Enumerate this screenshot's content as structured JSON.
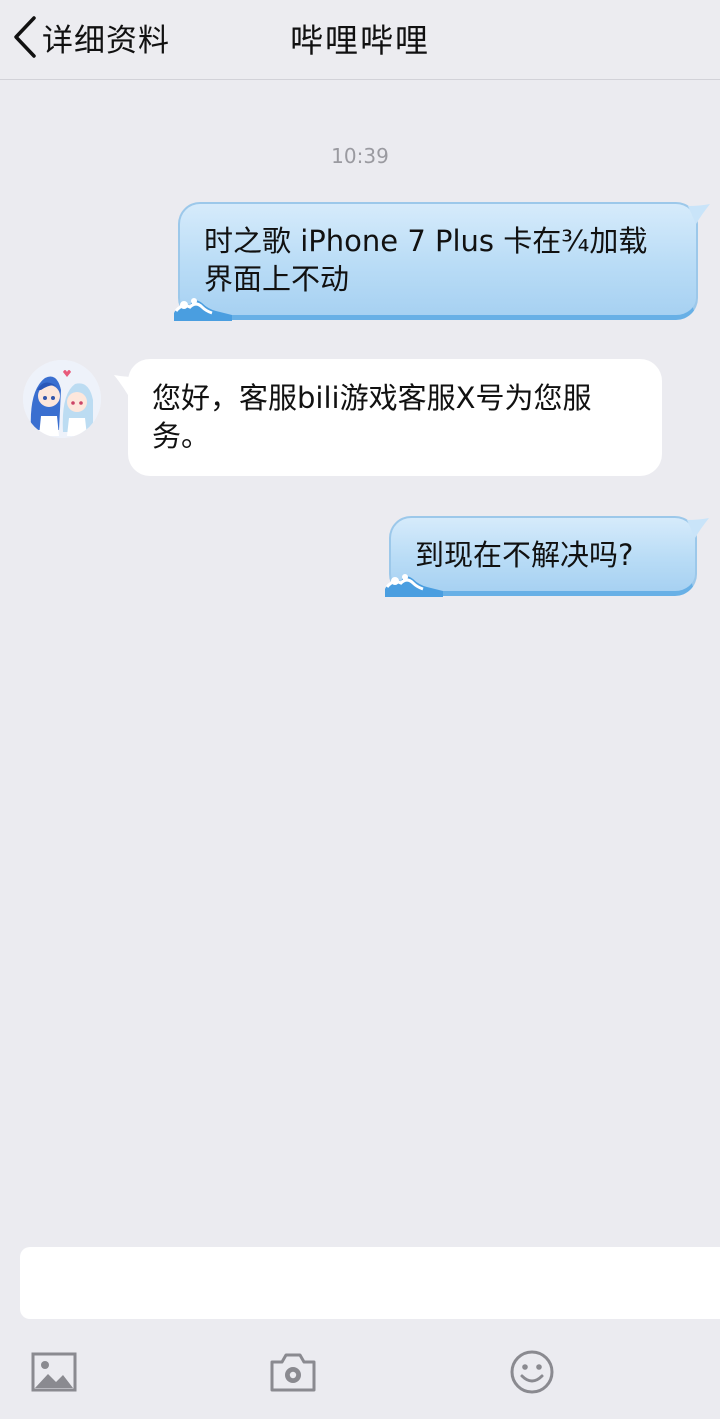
{
  "nav": {
    "back_label": "详细资料",
    "title": "哔哩哔哩"
  },
  "chat": {
    "timestamp": "10:39",
    "messages": [
      {
        "side": "outgoing",
        "text": "时之歌 iPhone 7 Plus 卡在¾加载\n界面上不动"
      },
      {
        "side": "incoming",
        "text": "您好，客服bili游戏客服X号为您服\n务。"
      },
      {
        "side": "outgoing",
        "text": "到现在不解决吗?"
      }
    ]
  },
  "input": {
    "placeholder": ""
  },
  "toolbar": {
    "icons": [
      "image-icon",
      "camera-icon",
      "emoji-icon"
    ]
  },
  "colors": {
    "background": "#ebebf0",
    "outgoing_bubble": "#b9dcf6",
    "incoming_bubble": "#ffffff",
    "icon_gray": "#8a8a90"
  }
}
